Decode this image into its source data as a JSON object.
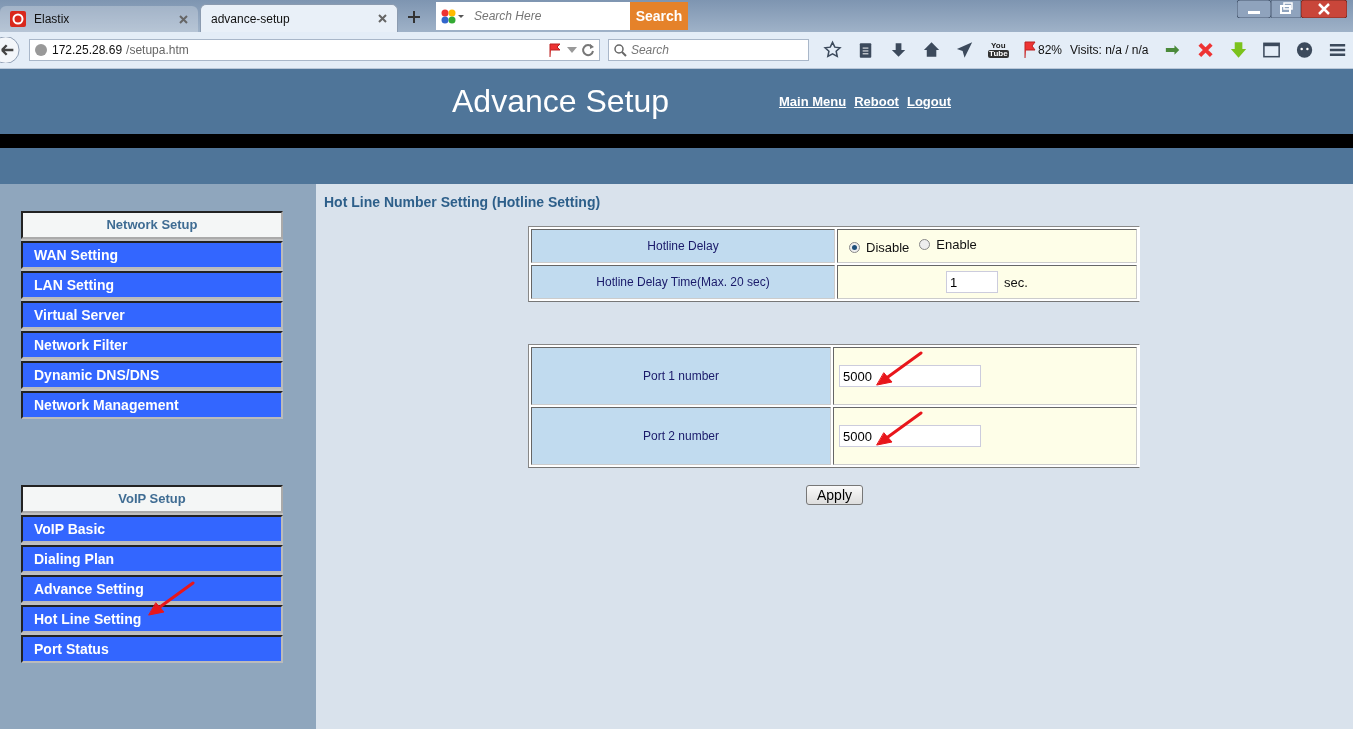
{
  "browser": {
    "tabs": [
      {
        "title": "Elastix",
        "selected": false
      },
      {
        "title": "advance-setup",
        "selected": true
      }
    ],
    "web_search": {
      "placeholder": "Search Here",
      "button": "Search"
    },
    "address": {
      "host": "172.25.28.69",
      "path": "/setupa.htm"
    },
    "search": {
      "placeholder": "Search"
    },
    "youtube_badge": {
      "top": "You",
      "bottom": "Tube"
    },
    "flag_reading": "82%",
    "visits": "Visits: n/a / n/a"
  },
  "header": {
    "title": "Advance Setup",
    "links": [
      "Main Menu",
      "Reboot",
      "Logout"
    ]
  },
  "sidebar": {
    "groups": [
      {
        "title": "Network Setup",
        "items": [
          "WAN Setting",
          "LAN Setting",
          "Virtual Server",
          "Network Filter",
          "Dynamic DNS/DNS",
          "Network Management"
        ]
      },
      {
        "title": "VoIP Setup",
        "items": [
          "VoIP Basic",
          "Dialing Plan",
          "Advance Setting",
          "Hot Line Setting",
          "Port Status"
        ]
      }
    ]
  },
  "content": {
    "heading": "Hot Line Number Setting (Hotline Setting)",
    "delay": {
      "label": "Hotline Delay",
      "options": [
        {
          "label": "Disable",
          "selected": true
        },
        {
          "label": "Enable",
          "selected": false
        }
      ]
    },
    "delay_time": {
      "label": "Hotline Delay Time(Max. 20 sec)",
      "value": "1",
      "unit": "sec."
    },
    "ports": [
      {
        "label": "Port 1 number",
        "value": "5000"
      },
      {
        "label": "Port 2 number",
        "value": "5000"
      }
    ],
    "apply": "Apply"
  }
}
